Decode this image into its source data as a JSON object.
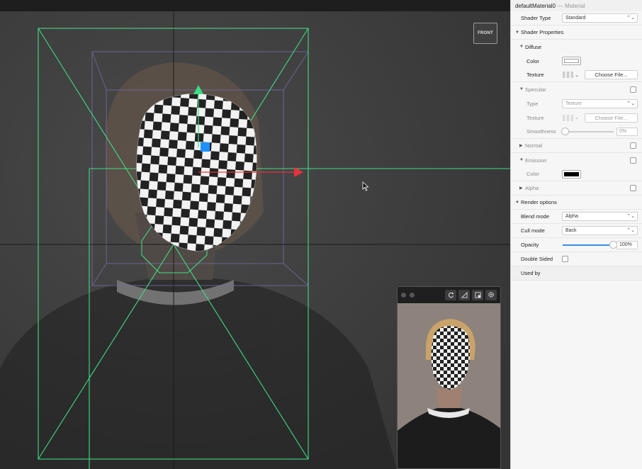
{
  "viewport": {
    "front_label": "FRONT"
  },
  "inspector": {
    "object_name": "defaultMaterial0",
    "object_type": "— Material",
    "shader_type_label": "Shader Type",
    "shader_type_value": "Standard",
    "shader_properties_label": "Shader Properties",
    "diffuse": {
      "label": "Diffuse",
      "color_label": "Color",
      "color_value": "#ffffff",
      "texture_label": "Texture",
      "choose_file": "Choose File..."
    },
    "specular": {
      "label": "Specular",
      "type_label": "Type",
      "type_value": "Texture",
      "texture_label": "Texture",
      "choose_file": "Choose File...",
      "smoothness_label": "Smoothness",
      "smoothness_value": "0%"
    },
    "normal_label": "Normal",
    "emission": {
      "label": "Emission",
      "color_label": "Color",
      "color_value": "#000000"
    },
    "alpha_label": "Alpha",
    "render_options": {
      "label": "Render options",
      "blend_mode_label": "Blend mode",
      "blend_mode_value": "Alpha",
      "cull_mode_label": "Cull mode",
      "cull_mode_value": "Back",
      "opacity_label": "Opacity",
      "opacity_value": "100%",
      "opacity_fraction": 1.0,
      "double_sided_label": "Double Sided"
    },
    "used_by_label": "Used by"
  },
  "colors": {
    "accent": "#3b8ce8",
    "guide_green": "#3ddc84",
    "axis_red": "#e8323c",
    "axis_blue": "#1e90ff"
  }
}
